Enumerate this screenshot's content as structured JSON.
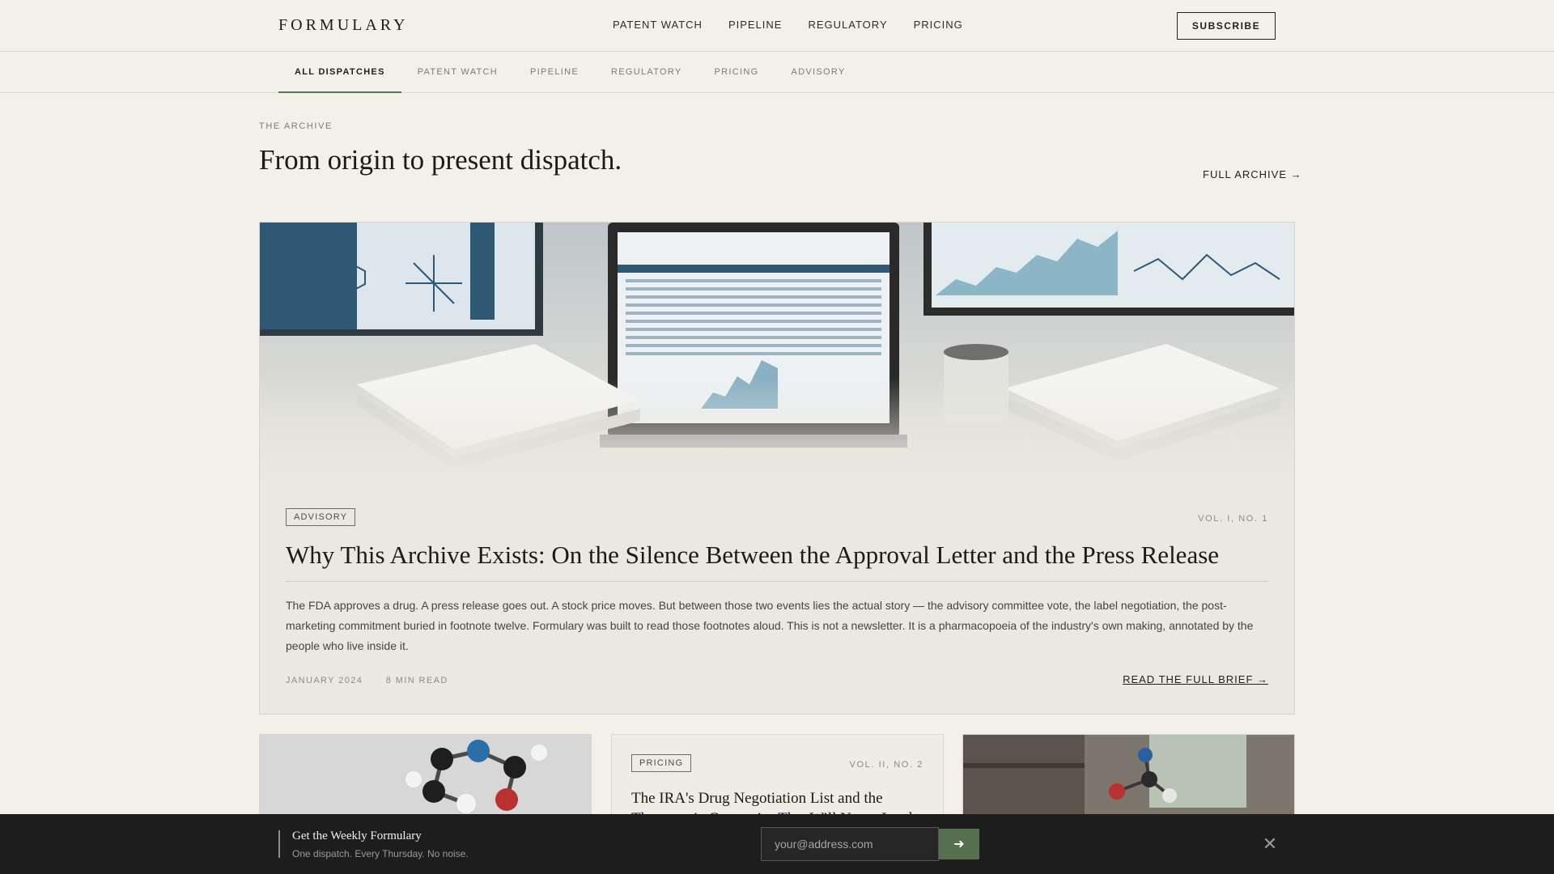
{
  "brand": {
    "logo": "FORMULARY"
  },
  "nav": {
    "items": [
      "PATENT WATCH",
      "PIPELINE",
      "REGULATORY",
      "PRICING"
    ],
    "subscribe": "SUBSCRIBE"
  },
  "tabs": {
    "items": [
      "ALL DISPATCHES",
      "PATENT WATCH",
      "PIPELINE",
      "REGULATORY",
      "PRICING",
      "ADVISORY"
    ],
    "active": "ALL DISPATCHES"
  },
  "section": {
    "eyebrow": "THE ARCHIVE",
    "title": "From origin to present dispatch.",
    "archive_link": "FULL ARCHIVE →"
  },
  "feature": {
    "tag": "ADVISORY",
    "volume": "VOL. I, NO. 1",
    "title": "Why This Archive Exists: On the Silence Between the Approval Letter and the Press Release",
    "excerpt": "The FDA approves a drug. A press release goes out. A stock price moves. But between those two events lies the actual story — the advisory committee vote, the label negotiation, the post-marketing commitment buried in footnote twelve. Formulary was built to read those footnotes aloud. This is not a newsletter. It is a pharmacopoeia of the industry's own making, annotated by the people who live inside it.",
    "date": "JANUARY 2024",
    "read_time": "8 MIN READ",
    "read_link": "READ THE FULL BRIEF →"
  },
  "cards": {
    "middle": {
      "tag": "PRICING",
      "volume": "VOL. II, NO. 2",
      "title": "The IRA's Drug Negotiation List and the Therapeutic Categories That Will Never Lead"
    }
  },
  "newsletter": {
    "title": "Get the Weekly Formulary",
    "subtitle": "One dispatch. Every Thursday. No noise.",
    "placeholder": "your@address.com",
    "submit_icon": "arrow-right-icon",
    "close_icon": "close-icon"
  },
  "colors": {
    "accent": "#5b7355",
    "background": "#f3f0e9",
    "dark_bar": "#1d1d1d"
  }
}
